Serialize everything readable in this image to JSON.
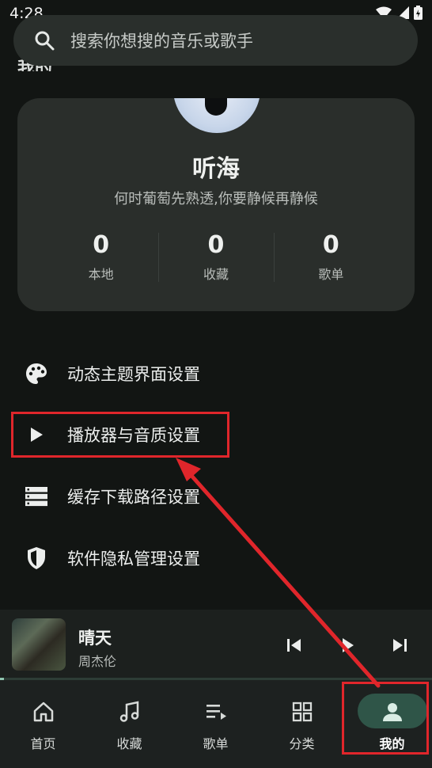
{
  "status_bar": {
    "time": "4:28"
  },
  "search": {
    "placeholder": "搜索你想搜的音乐或歌手"
  },
  "section": {
    "title": "我的"
  },
  "profile": {
    "name": "听海",
    "bio": "何时葡萄先熟透,你要静候再静候",
    "stats": [
      {
        "value": "0",
        "label": "本地"
      },
      {
        "value": "0",
        "label": "收藏"
      },
      {
        "value": "0",
        "label": "歌单"
      }
    ]
  },
  "menu": [
    {
      "label": "动态主题界面设置",
      "icon": "palette-icon"
    },
    {
      "label": "播放器与音质设置",
      "icon": "play-icon"
    },
    {
      "label": "缓存下载路径设置",
      "icon": "storage-icon"
    },
    {
      "label": "软件隐私管理设置",
      "icon": "shield-icon"
    }
  ],
  "player": {
    "title": "晴天",
    "artist": "周杰伦",
    "progress": 0.01
  },
  "nav": [
    {
      "label": "首页",
      "icon": "home-icon"
    },
    {
      "label": "收藏",
      "icon": "music-note-icon"
    },
    {
      "label": "歌单",
      "icon": "playlist-icon"
    },
    {
      "label": "分类",
      "icon": "grid-icon"
    },
    {
      "label": "我的",
      "icon": "person-icon",
      "active": true
    }
  ],
  "colors": {
    "accent": "#8fc6b0",
    "annotation": "#e0262b",
    "background": "#121513"
  }
}
